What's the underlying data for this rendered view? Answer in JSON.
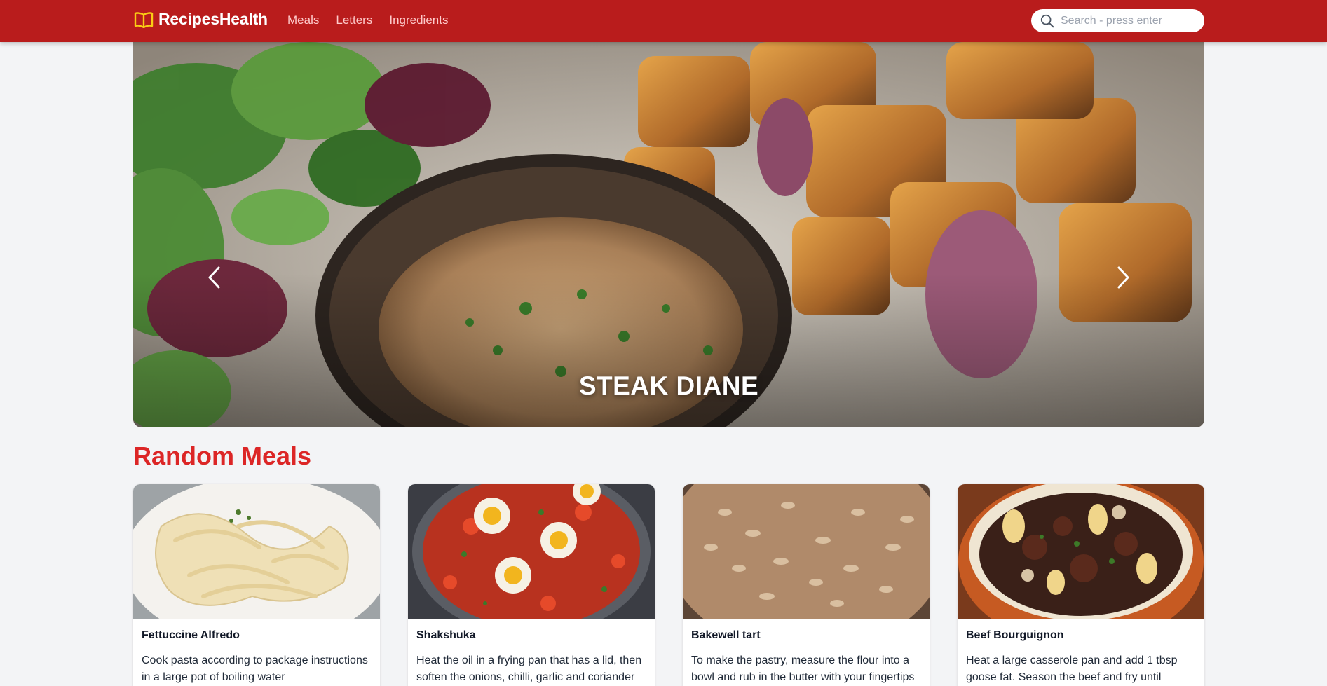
{
  "header": {
    "brand": "RecipesHealth",
    "brand_icon": "book-icon",
    "nav": [
      {
        "label": "Meals"
      },
      {
        "label": "Letters"
      },
      {
        "label": "Ingredients"
      }
    ],
    "search_placeholder": "Search - press enter",
    "search_icon": "magnifier-icon",
    "colors": {
      "header_bg": "#b91c1c",
      "brand_icon": "#facc15"
    }
  },
  "hero": {
    "title": "STEAK DIANE",
    "prev_icon": "chevron-left-icon",
    "next_icon": "chevron-right-icon"
  },
  "random_meals": {
    "title": "Random Meals",
    "items": [
      {
        "name": "Fettuccine Alfredo",
        "text": "Cook pasta according to package instructions in a large pot of boiling water"
      },
      {
        "name": "Shakshuka",
        "text": "Heat the oil in a frying pan that has a lid, then soften the onions, chilli, garlic and coriander"
      },
      {
        "name": "Bakewell tart",
        "text": "To make the pastry, measure the flour into a bowl and rub in the butter with your fingertips"
      },
      {
        "name": "Beef Bourguignon",
        "text": "Heat a large casserole pan and add 1 tbsp goose fat. Season the beef and fry until"
      }
    ]
  }
}
